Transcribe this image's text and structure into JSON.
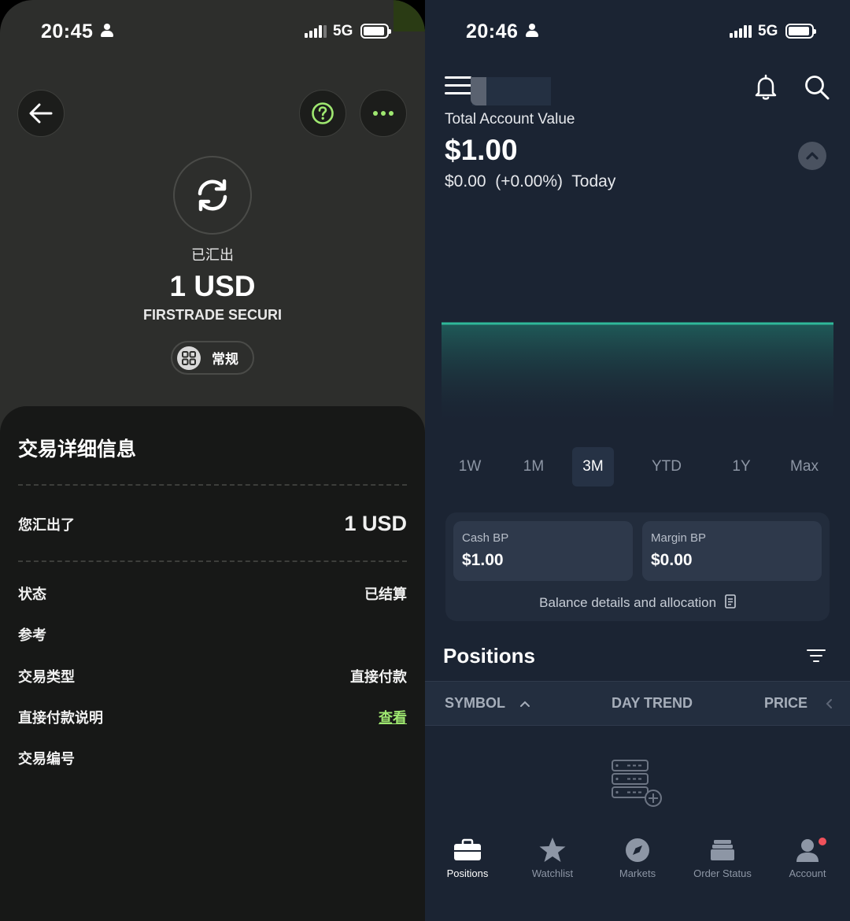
{
  "left": {
    "status_bar": {
      "time": "20:45",
      "network": "5G"
    },
    "status_label": "已汇出",
    "amount": "1 USD",
    "recipient": "FIRSTRADE SECURI",
    "category_pill": "常规",
    "details": {
      "title": "交易详细信息",
      "you_sent_label": "您汇出了",
      "you_sent_value": "1 USD",
      "rows": [
        {
          "label": "状态",
          "value": "已结算"
        },
        {
          "label": "参考",
          "value": ""
        },
        {
          "label": "交易类型",
          "value": "直接付款"
        },
        {
          "label": "直接付款说明",
          "value": "查看"
        },
        {
          "label": "交易编号",
          "value": ""
        }
      ]
    },
    "colors": {
      "accent": "#9fe870",
      "background": "#2d2e2c",
      "sheet": "#171817"
    }
  },
  "right": {
    "status_bar": {
      "time": "20:46",
      "network": "5G"
    },
    "account": {
      "label": "Total Account Value",
      "value": "$1.00",
      "change": "$0.00  (+0.00%)  Today"
    },
    "chart_data": {
      "type": "area",
      "series": [
        {
          "values": [
            1.0,
            1.0,
            1.0,
            1.0,
            1.0,
            1.0,
            1.0,
            1.0,
            1.0,
            1.0
          ]
        }
      ],
      "color": "#2fb89a"
    },
    "ranges": [
      "1W",
      "1M",
      "3M",
      "YTD",
      "1Y",
      "Max"
    ],
    "active_range": "3M",
    "buying_power": {
      "cash_label": "Cash BP",
      "cash_value": "$1.00",
      "margin_label": "Margin BP",
      "margin_value": "$0.00",
      "details_link": "Balance details and allocation"
    },
    "positions": {
      "title": "Positions",
      "columns": [
        "SYMBOL",
        "DAY TREND",
        "PRICE"
      ]
    },
    "tabs": [
      {
        "label": "Positions",
        "icon": "briefcase-icon",
        "active": true
      },
      {
        "label": "Watchlist",
        "icon": "star-icon",
        "active": false
      },
      {
        "label": "Markets",
        "icon": "compass-icon",
        "active": false
      },
      {
        "label": "Order Status",
        "icon": "tray-icon",
        "active": false
      },
      {
        "label": "Account",
        "icon": "person-icon",
        "active": false
      }
    ],
    "colors": {
      "background": "#1b2433",
      "badge": "#f0515b"
    }
  }
}
